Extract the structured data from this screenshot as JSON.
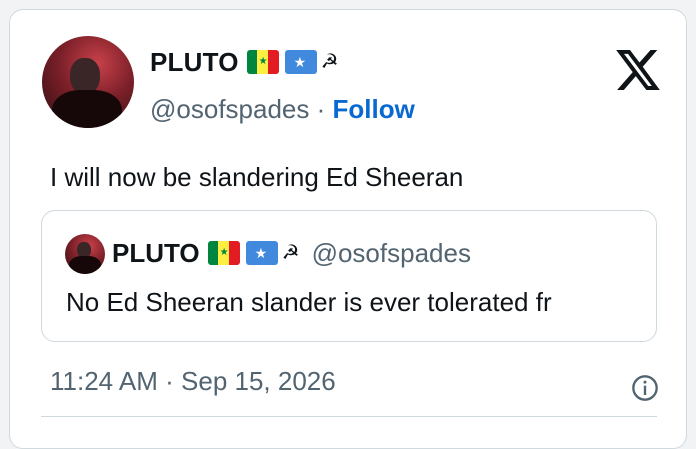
{
  "tweet": {
    "author_name": "PLUTO",
    "author_handle": "@osofspades",
    "separator": "·",
    "follow_label": "Follow",
    "hammer_sickle": "☭",
    "text": "I will now be slandering Ed Sheeran",
    "timestamp": "11:24 AM · Sep 15, 2026"
  },
  "quoted_tweet": {
    "author_name": "PLUTO",
    "author_handle": "@osofspades",
    "hammer_sickle": "☭",
    "text": "No Ed Sheeran slander is ever tolerated fr"
  },
  "icons": {
    "logo": "x-logo-icon",
    "info": "info-icon",
    "flag_1": "senegal-flag-icon",
    "flag_2": "somalia-flag-icon"
  },
  "colors": {
    "accent": "#0969d2",
    "text_primary": "#0f1419",
    "text_secondary": "#536471",
    "border": "#cfd9de"
  }
}
